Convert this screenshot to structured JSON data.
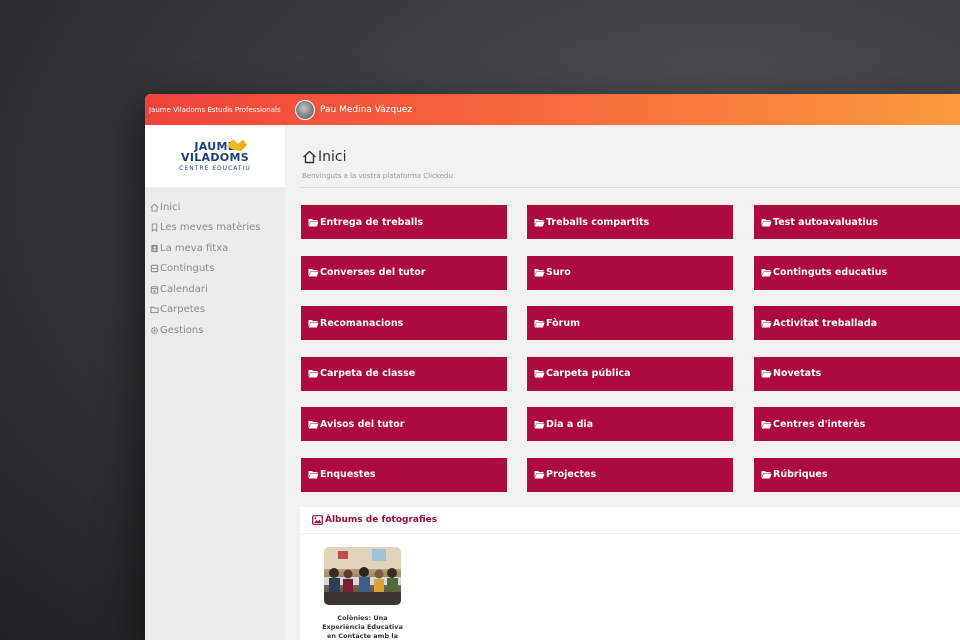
{
  "topbar": {
    "school_name": "Jaume Viladoms Estudis Professionals",
    "user_name": "Pau Medina Vázquez"
  },
  "logo": {
    "line1": "JAUME",
    "line2": "VILADOMS",
    "subtitle": "CENTRE  EDUCATIU"
  },
  "sidebar": {
    "items": [
      {
        "label": "Inici",
        "icon": "home-icon"
      },
      {
        "label": "Les meves matèries",
        "icon": "bookmark-icon"
      },
      {
        "label": "La meva fitxa",
        "icon": "id-card-icon"
      },
      {
        "label": "Continguts",
        "icon": "layers-icon"
      },
      {
        "label": "Calendari",
        "icon": "calendar-icon"
      },
      {
        "label": "Carpetes",
        "icon": "folder-icon"
      },
      {
        "label": "Gestions",
        "icon": "gear-icon"
      }
    ]
  },
  "main": {
    "title": "Inici",
    "subtitle": "Benvinguts a la vostra plataforma Clickedu",
    "tiles": [
      "Entrega de treballs",
      "Treballs compartits",
      "Test autoavaluatius",
      "Converses del tutor",
      "Suro",
      "Continguts educatius",
      "Recomanacions",
      "Fòrum",
      "Activitat treballada",
      "Carpeta de classe",
      "Carpeta pública",
      "Novetats",
      "Avisos del tutor",
      "Dia a dia",
      "Centres d'interès",
      "Enquestes",
      "Projectes",
      "Rúbriques"
    ],
    "albums": {
      "heading": "Àlbums de fotografies",
      "items": [
        {
          "caption": "Colònies: Una Experiència Educativa en Contacte amb la"
        }
      ]
    }
  },
  "colors": {
    "tile": "#ad0a3e",
    "topbar_start": "#f0433c",
    "topbar_end": "#fa9a3e",
    "brand_blue": "#1f3e7c",
    "brand_yellow": "#f3c421"
  }
}
